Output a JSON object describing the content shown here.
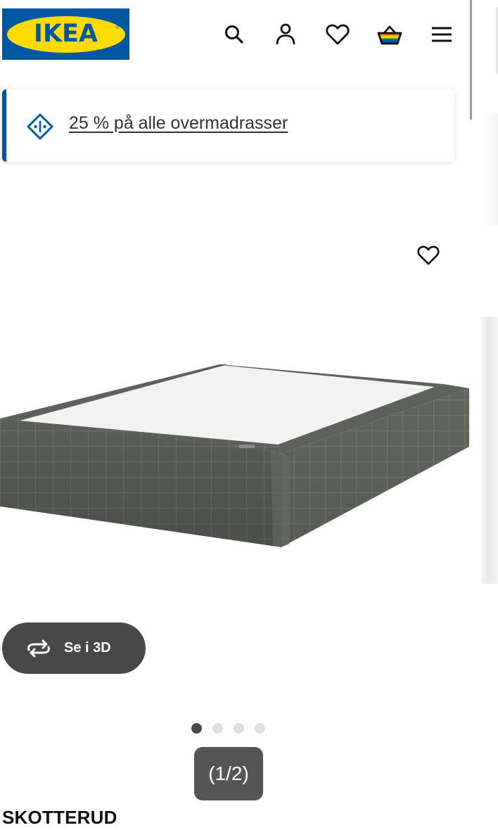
{
  "header": {
    "logo_text": "IKEA",
    "logo_reg": "®",
    "icons": [
      "search-icon",
      "user-icon",
      "heart-icon",
      "basket-icon",
      "menu-icon"
    ],
    "brand_blue": "#0058a3",
    "brand_yellow": "#ffdb00"
  },
  "promo": {
    "text": "25 % på alle overmadrasser",
    "icon": "tag-icon",
    "accent": "#0058a3"
  },
  "gallery": {
    "favourite_icon": "heart-icon",
    "view_3d_label": "Se i 3D",
    "view_3d_icon": "rotate-3d-icon",
    "dots_total": 4,
    "dots_active": 1,
    "counter": "(1/2)"
  },
  "product": {
    "name": "SKOTTERUD"
  }
}
